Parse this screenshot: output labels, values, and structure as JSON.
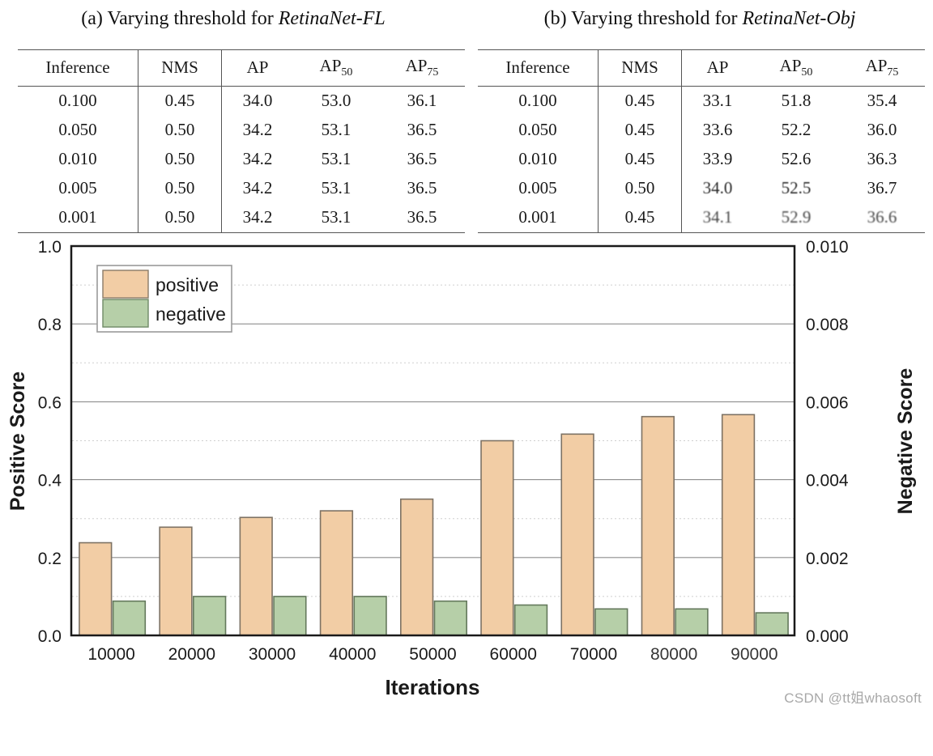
{
  "tables": [
    {
      "caption_prefix": "(a) Varying threshold for ",
      "caption_model": "RetinaNet-FL",
      "columns": [
        "Inference",
        "NMS",
        "AP",
        "AP50",
        "AP75"
      ],
      "column_labels": {
        "inference": "Inference",
        "nms": "NMS",
        "ap": "AP",
        "ap50_base": "AP",
        "ap50_sub": "50",
        "ap75_base": "AP",
        "ap75_sub": "75"
      },
      "rows": [
        {
          "inference": "0.100",
          "nms": "0.45",
          "ap": "34.0",
          "ap50": "53.0",
          "ap75": "36.1",
          "bold": [
            false,
            false,
            false,
            false,
            false
          ]
        },
        {
          "inference": "0.050",
          "nms": "0.50",
          "ap": "34.2",
          "ap50": "53.1",
          "ap75": "36.5",
          "bold": [
            false,
            false,
            true,
            true,
            true
          ]
        },
        {
          "inference": "0.010",
          "nms": "0.50",
          "ap": "34.2",
          "ap50": "53.1",
          "ap75": "36.5",
          "bold": [
            false,
            false,
            true,
            true,
            true
          ]
        },
        {
          "inference": "0.005",
          "nms": "0.50",
          "ap": "34.2",
          "ap50": "53.1",
          "ap75": "36.5",
          "bold": [
            false,
            false,
            true,
            true,
            true
          ]
        },
        {
          "inference": "0.001",
          "nms": "0.50",
          "ap": "34.2",
          "ap50": "53.1",
          "ap75": "36.5",
          "bold": [
            false,
            false,
            true,
            true,
            true
          ]
        }
      ]
    },
    {
      "caption_prefix": "(b) Varying threshold for ",
      "caption_model": "RetinaNet-Obj",
      "columns": [
        "Inference",
        "NMS",
        "AP",
        "AP50",
        "AP75"
      ],
      "rows": [
        {
          "inference": "0.100",
          "nms": "0.45",
          "ap": "33.1",
          "ap50": "51.8",
          "ap75": "35.4",
          "bold": [
            false,
            false,
            false,
            false,
            false
          ]
        },
        {
          "inference": "0.050",
          "nms": "0.45",
          "ap": "33.6",
          "ap50": "52.2",
          "ap75": "36.0",
          "bold": [
            false,
            false,
            false,
            false,
            false
          ]
        },
        {
          "inference": "0.010",
          "nms": "0.45",
          "ap": "33.9",
          "ap50": "52.6",
          "ap75": "36.3",
          "bold": [
            false,
            false,
            false,
            false,
            false
          ]
        },
        {
          "inference": "0.005",
          "nms": "0.50",
          "ap": "34.0",
          "ap50": "52.5",
          "ap75": "36.7",
          "bold": [
            false,
            false,
            false,
            false,
            true
          ]
        },
        {
          "inference": "0.001",
          "nms": "0.45",
          "ap": "34.1",
          "ap50": "52.9",
          "ap75": "36.6",
          "bold": [
            true,
            true,
            true,
            true,
            false
          ]
        }
      ]
    }
  ],
  "chart_data": {
    "type": "bar",
    "title": "",
    "xlabel": "Iterations",
    "ylabel": "Positive Score",
    "y2label": "Negative Score",
    "categories": [
      "10000",
      "20000",
      "30000",
      "40000",
      "50000",
      "60000",
      "70000",
      "80000",
      "90000"
    ],
    "series": [
      {
        "name": "positive",
        "axis": "left",
        "color": "#F2CDA5",
        "values": [
          0.238,
          0.278,
          0.303,
          0.32,
          0.35,
          0.5,
          0.517,
          0.562,
          0.567
        ]
      },
      {
        "name": "negative",
        "axis": "right",
        "color": "#B6CFA8",
        "values": [
          0.00088,
          0.001,
          0.001,
          0.001,
          0.00088,
          0.00078,
          0.00068,
          0.00068,
          0.00058
        ]
      }
    ],
    "ylim": [
      0.0,
      1.0
    ],
    "y2lim": [
      0.0,
      0.01
    ],
    "yticks": [
      "0.0",
      "0.2",
      "0.4",
      "0.6",
      "0.8",
      "1.0"
    ],
    "y2ticks": [
      "0.000",
      "0.002",
      "0.004",
      "0.006",
      "0.008",
      "0.010"
    ],
    "grid": true,
    "legend_position": "upper-left",
    "legend_entries": [
      "positive",
      "negative"
    ]
  },
  "watermark": "CSDN @tt姐whaosoft"
}
